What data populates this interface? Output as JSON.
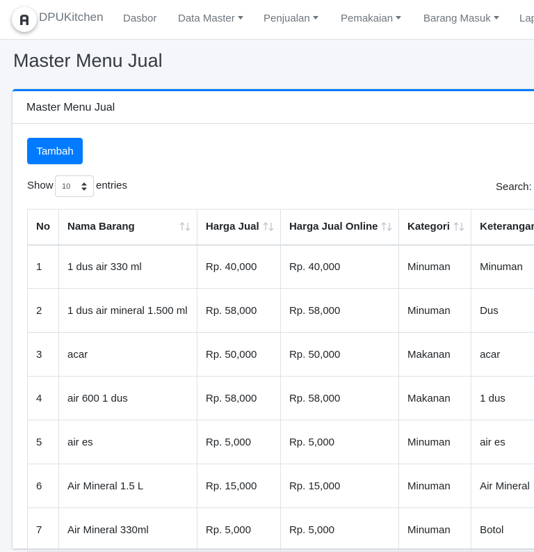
{
  "navbar": {
    "brand": "DPUKitchen",
    "items": [
      {
        "label": "Dasbor",
        "dropdown": false
      },
      {
        "label": "Data Master",
        "dropdown": true
      },
      {
        "label": "Penjualan",
        "dropdown": true
      },
      {
        "label": "Pemakaian",
        "dropdown": true
      },
      {
        "label": "Barang Masuk",
        "dropdown": true
      },
      {
        "label": "Lap",
        "dropdown": false
      }
    ]
  },
  "page": {
    "title": "Master Menu Jual"
  },
  "card": {
    "title": "Master Menu Jual",
    "add_button": "Tambah",
    "show_label": "Show",
    "entries_value": "10",
    "entries_label": "entries",
    "search_label": "Search:"
  },
  "table": {
    "columns": [
      "No",
      "Nama Barang",
      "Harga Jual",
      "Harga Jual Online",
      "Kategori",
      "Keterangan"
    ],
    "rows": [
      [
        "1",
        "1 dus air 330 ml",
        "Rp. 40,000",
        "Rp. 40,000",
        "Minuman",
        "Minuman"
      ],
      [
        "2",
        "1 dus air mineral 1.500 ml",
        "Rp. 58,000",
        "Rp. 58,000",
        "Minuman",
        "Dus"
      ],
      [
        "3",
        "acar",
        "Rp. 50,000",
        "Rp. 50,000",
        "Makanan",
        "acar"
      ],
      [
        "4",
        "air 600 1 dus",
        "Rp. 58,000",
        "Rp. 58,000",
        "Makanan",
        "1 dus"
      ],
      [
        "5",
        "air es",
        "Rp. 5,000",
        "Rp. 5,000",
        "Minuman",
        "air es"
      ],
      [
        "6",
        "Air Mineral 1.5 L",
        "Rp. 15,000",
        "Rp. 15,000",
        "Minuman",
        "Air Mineral"
      ],
      [
        "7",
        "Air Mineral 330ml",
        "Rp. 5,000",
        "Rp. 5,000",
        "Minuman",
        "Botol"
      ]
    ]
  },
  "colors": {
    "accent": "#007bff",
    "nav_text": "#6c757d",
    "background": "#f4f6f9"
  },
  "icons": {
    "brand": "logo-icon",
    "sort": "sort-arrows-icon",
    "select": "updown-icon"
  }
}
